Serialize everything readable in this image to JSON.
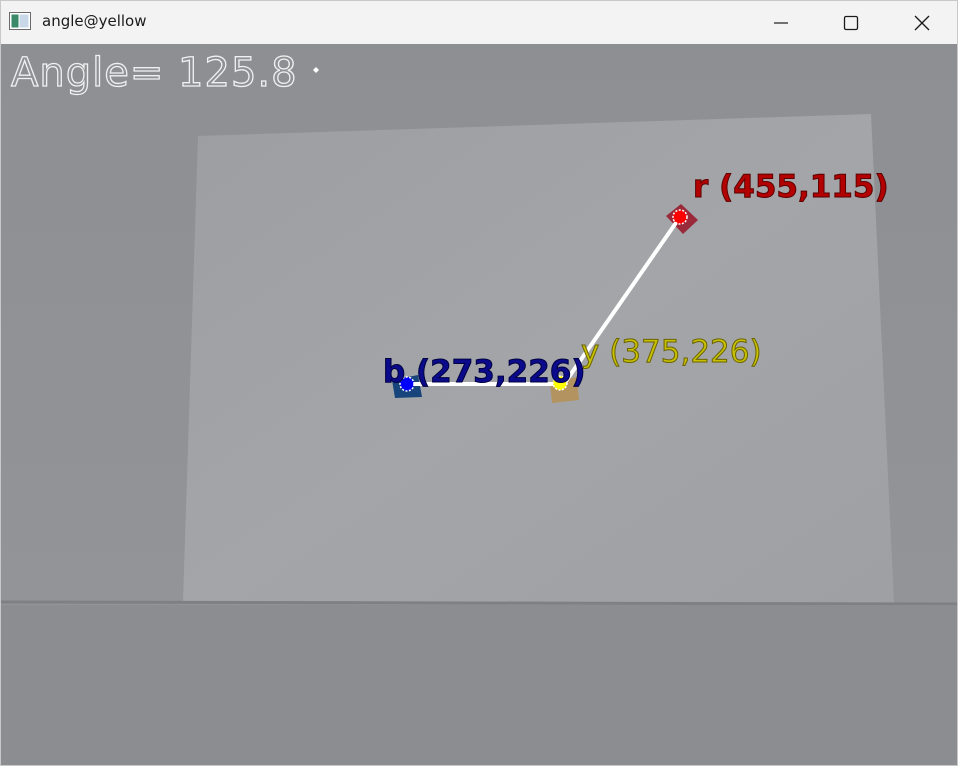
{
  "window": {
    "title": "angle@yellow",
    "controls": [
      "minimize",
      "maximize",
      "close"
    ]
  },
  "overlay": {
    "angle_text": "Angle=  125.8"
  },
  "points": {
    "r": {
      "label": "r (455,115)",
      "color": "#ff0000"
    },
    "y": {
      "label": "y (375,226)",
      "color": "#ffff00"
    },
    "b": {
      "label": "b (273,226)",
      "color": "#0000ff"
    }
  },
  "icons": [
    "app-window-icon",
    "minimize-icon",
    "maximize-icon",
    "close-icon"
  ]
}
